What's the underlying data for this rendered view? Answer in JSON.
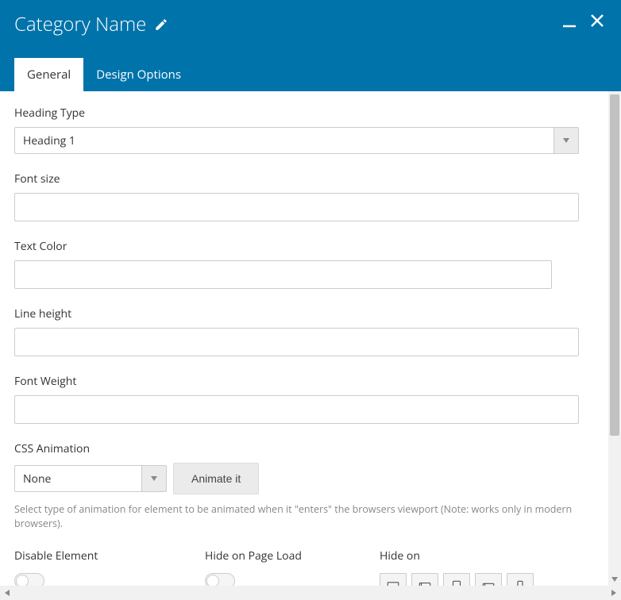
{
  "header": {
    "title": "Category Name"
  },
  "tabs": [
    {
      "label": "General",
      "active": true
    },
    {
      "label": "Design Options",
      "active": false
    }
  ],
  "fields": {
    "heading_type": {
      "label": "Heading Type",
      "value": "Heading 1"
    },
    "font_size": {
      "label": "Font size",
      "value": ""
    },
    "text_color": {
      "label": "Text Color",
      "value": ""
    },
    "line_height": {
      "label": "Line height",
      "value": ""
    },
    "font_weight": {
      "label": "Font Weight",
      "value": ""
    },
    "css_animation": {
      "label": "CSS Animation",
      "value": "None",
      "button": "Animate it",
      "help": "Select type of animation for element to be animated when it \"enters\" the browsers viewport (Note: works only in modern browsers)."
    },
    "disable_element": {
      "label": "Disable Element"
    },
    "hide_on_load": {
      "label": "Hide on Page Load"
    },
    "hide_on": {
      "label": "Hide on"
    }
  },
  "device_icons": [
    "desktop",
    "tablet-landscape",
    "tablet-portrait",
    "phone-landscape",
    "phone-portrait"
  ]
}
